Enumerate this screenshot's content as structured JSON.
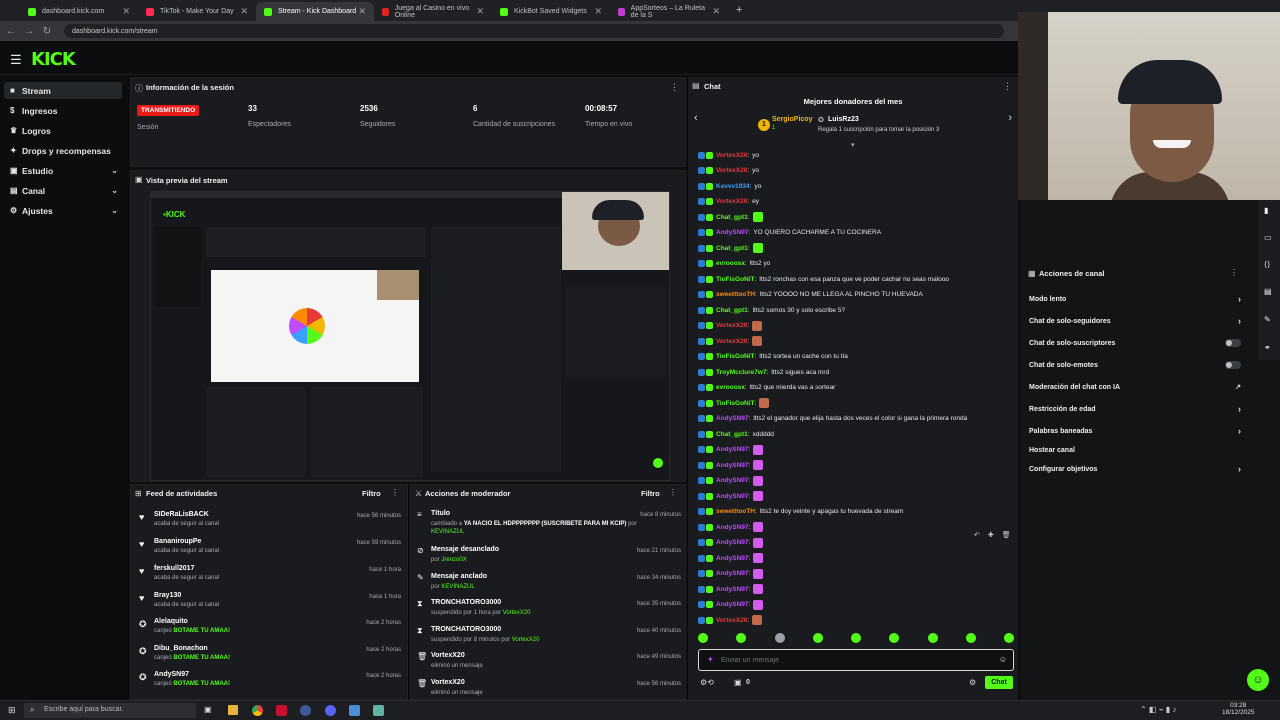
{
  "browser": {
    "tabs": [
      {
        "label": "dashboard.kick.com",
        "color": "#53fc18"
      },
      {
        "label": "TikTok - Make Your Day",
        "color": "#111"
      },
      {
        "label": "Stream - Kick Dashboard",
        "color": "#53fc18"
      },
      {
        "label": "Juega al Casino en vivo Online",
        "color": "#e02323"
      },
      {
        "label": "KickBot Saved Widgets",
        "color": "#53fc18"
      },
      {
        "label": "AppSorteos – La Ruleta de la S",
        "color": "#c43cd1"
      }
    ],
    "url": "dashboard.kick.com/stream"
  },
  "brand": {
    "logo": "KICK",
    "accent": "#53fc18"
  },
  "sidebar": {
    "items": [
      {
        "label": "Stream",
        "icon": "stream-icon"
      },
      {
        "label": "Ingresos",
        "icon": "money-icon"
      },
      {
        "label": "Logros",
        "icon": "trophy-icon"
      },
      {
        "label": "Drops y recompensas",
        "icon": "gift-icon"
      },
      {
        "label": "Estudio",
        "icon": "studio-icon"
      },
      {
        "label": "Canal",
        "icon": "channel-icon"
      },
      {
        "label": "Ajustes",
        "icon": "settings-icon"
      }
    ]
  },
  "session": {
    "title": "Información de la sesión",
    "badge": "TRANSMITIENDO",
    "badge_label": "Sesión",
    "stats": [
      {
        "value": "33",
        "label": "Espectadores"
      },
      {
        "value": "2536",
        "label": "Seguidores"
      },
      {
        "value": "6",
        "label": "Cantidad de suscripciones"
      },
      {
        "value": "00:08:57",
        "label": "Tiempo en vivo"
      }
    ]
  },
  "preview": {
    "title": "Vista previa del stream"
  },
  "activity": {
    "title": "Feed de actividades",
    "filter": "Filtro",
    "items": [
      {
        "name": "SIDeRaLisBACK",
        "sub": "acaba de seguir al canal",
        "prize": "",
        "time": "hace 56 minutos"
      },
      {
        "name": "BananiroupPe",
        "sub": "acaba de seguir al canal",
        "prize": "",
        "time": "hace 59 minutos"
      },
      {
        "name": "ferskull2017",
        "sub": "acaba de seguir al canal",
        "prize": "",
        "time": "hace 1 hora"
      },
      {
        "name": "Bray130",
        "sub": "acaba de seguir al canal",
        "prize": "",
        "time": "hace 1 hora"
      },
      {
        "name": "Alelaquito",
        "sub": "canjeó",
        "prize": "BOTAME TU AMAA!",
        "time": "hace 2 horas"
      },
      {
        "name": "Dibu_Bonachon",
        "sub": "canjeó",
        "prize": "BOTAME TU AMAA!",
        "time": "hace 2 horas"
      },
      {
        "name": "AndySN97",
        "sub": "canjeó",
        "prize": "BOTAME TU AMAA!",
        "time": "hace 2 horas"
      }
    ]
  },
  "modactions": {
    "title": "Acciones de moderador",
    "filter": "Filtro",
    "items": [
      {
        "name": "Título",
        "sub": "cambiado a",
        "detail": "YA NACIO EL HDPPPPPPP (SUSCRIBETE PARA MI KCIP)",
        "sub2": "por",
        "by": "KEVINAZUL",
        "time": "hace 8 minutos",
        "icon": "title-icon"
      },
      {
        "name": "Mensaje desanclado",
        "sub": "por",
        "detail": "",
        "sub2": "",
        "by": "Jrenzo0X",
        "time": "hace 21 minutos",
        "icon": "unpin-icon"
      },
      {
        "name": "Mensaje anclado",
        "sub": "por",
        "detail": "",
        "sub2": "",
        "by": "KEVINAZUL",
        "time": "hace 34 minutos",
        "icon": "pin-icon"
      },
      {
        "name": "TRONCHATORO3000",
        "sub": "suspendido por 1 hora por",
        "detail": "",
        "sub2": "",
        "by": "VortexX20",
        "time": "hace 35 minutos",
        "icon": "timeout-icon"
      },
      {
        "name": "TRONCHATORO3000",
        "sub": "suspendido por 8 minutos por",
        "detail": "",
        "sub2": "",
        "by": "VortexX20",
        "time": "hace 40 minutos",
        "icon": "timeout-icon"
      },
      {
        "name": "VortexX20",
        "sub": "eliminó un mensaje",
        "detail": "",
        "sub2": "",
        "by": "",
        "time": "hace 49 minutos",
        "icon": "trash-icon"
      },
      {
        "name": "VortexX20",
        "sub": "eliminó un mensaje",
        "detail": "",
        "sub2": "",
        "by": "",
        "time": "hace 56 minutos",
        "icon": "trash-icon"
      }
    ]
  },
  "chat": {
    "title": "Chat",
    "donors_title": "Mejores donadores del mes",
    "donor1": "SergioPicoy",
    "donor1_count": "1",
    "donor2": "LuisRz23",
    "donor_hint": "Regala 1 suscripción para tomar la posición 3",
    "input_placeholder": "Enviar un mensaje",
    "send_label": "Chat",
    "viewer_count": "0",
    "messages": [
      {
        "user": "VortexX20",
        "color": "#e83a3a",
        "text": "yo"
      },
      {
        "user": "VortexX20",
        "color": "#e83a3a",
        "text": "yo"
      },
      {
        "user": "Kevvv1934",
        "color": "#3aa0ff",
        "text": "yo"
      },
      {
        "user": "VortexX20",
        "color": "#e83a3a",
        "text": "ey"
      },
      {
        "user": "Chat_gpt1",
        "color": "#53fc18",
        "text": "",
        "emote": "#53fc18"
      },
      {
        "user": "AndySN97",
        "color": "#c04bff",
        "text": "YO QUIERO CACHARME A TU COCINERA"
      },
      {
        "user": "Chat_gpt1",
        "color": "#53fc18",
        "text": "",
        "emote": "#53fc18"
      },
      {
        "user": "evrooosx",
        "color": "#53fc18",
        "text": "ltts2 yo"
      },
      {
        "user": "TioFisGoNiT",
        "color": "#53fc18",
        "text": "ltts2 ronchas con esa panza que ve poder cachar no seas malooo"
      },
      {
        "user": "sweetttooTH",
        "color": "#ff8a00",
        "text": "ltts2 YOOOO NO ME LLEGA AL PINCHO TU HUEVADA"
      },
      {
        "user": "Chat_gpt1",
        "color": "#53fc18",
        "text": "ltts2 somos 30 y solo escribe 5?"
      },
      {
        "user": "VortexX20",
        "color": "#e83a3a",
        "text": "",
        "emote": "#c0694b"
      },
      {
        "user": "VortexX20",
        "color": "#e83a3a",
        "text": "",
        "emote": "#c0694b"
      },
      {
        "user": "TioFisGoNiT",
        "color": "#53fc18",
        "text": "ltts2 sortea un cache con tu tía"
      },
      {
        "user": "TroyMcclure7w7",
        "color": "#53fc18",
        "text": "ltts2 sigues aca mrd"
      },
      {
        "user": "evrooosx",
        "color": "#53fc18",
        "text": "ltts2 que mierda vas a sortear"
      },
      {
        "user": "TioFisGoNiT",
        "color": "#53fc18",
        "text": "",
        "emote": "#c0694b"
      },
      {
        "user": "AndySN97",
        "color": "#c04bff",
        "text": "ltts2 el ganador que elija hasta dos veces el color si gana la primera ronda"
      },
      {
        "user": "Chat_gpt1",
        "color": "#53fc18",
        "text": "xddddd"
      },
      {
        "user": "AndySN97",
        "color": "#c04bff",
        "text": "",
        "emote": "#d45cf0"
      },
      {
        "user": "AndySN97",
        "color": "#c04bff",
        "text": "",
        "emote": "#d45cf0"
      },
      {
        "user": "AndySN97",
        "color": "#c04bff",
        "text": "",
        "emote": "#d45cf0"
      },
      {
        "user": "AndySN97",
        "color": "#c04bff",
        "text": "",
        "emote": "#d45cf0"
      },
      {
        "user": "sweetttooTH",
        "color": "#ff8a00",
        "text": "ltts2 te doy veinte y apagas tu huevada de stream"
      },
      {
        "user": "AndySN97",
        "color": "#c04bff",
        "text": "",
        "emote": "#d45cf0"
      },
      {
        "user": "AndySN97",
        "color": "#c04bff",
        "text": "",
        "emote": "#d45cf0"
      },
      {
        "user": "AndySN97",
        "color": "#c04bff",
        "text": "",
        "emote": "#d45cf0"
      },
      {
        "user": "AndySN97",
        "color": "#c04bff",
        "text": "",
        "emote": "#d45cf0"
      },
      {
        "user": "AndySN97",
        "color": "#c04bff",
        "text": "",
        "emote": "#d45cf0"
      },
      {
        "user": "AndySN97",
        "color": "#c04bff",
        "text": "",
        "emote": "#d45cf0"
      },
      {
        "user": "VortexX20",
        "color": "#e83a3a",
        "text": "",
        "emote": "#c0694b"
      }
    ]
  },
  "channel_actions": {
    "title": "Acciones de canal",
    "items": [
      {
        "label": "Modo lento",
        "control": "arrow"
      },
      {
        "label": "Chat de solo-seguidores",
        "control": "arrow"
      },
      {
        "label": "Chat de solo-suscriptores",
        "control": "toggle"
      },
      {
        "label": "Chat de solo-emotes",
        "control": "toggle"
      },
      {
        "label": "Moderación del chat con IA",
        "control": "icon"
      },
      {
        "label": "Restricción de edad",
        "control": "arrow"
      },
      {
        "label": "Palabras baneadas",
        "control": "arrow"
      },
      {
        "label": "Hostear canal",
        "control": "none"
      },
      {
        "label": "Configurar objetivos",
        "control": "arrow"
      }
    ]
  },
  "taskbar": {
    "search_placeholder": "Escribe aquí para buscar.",
    "time": "03:28",
    "date": "18/12/2025"
  }
}
